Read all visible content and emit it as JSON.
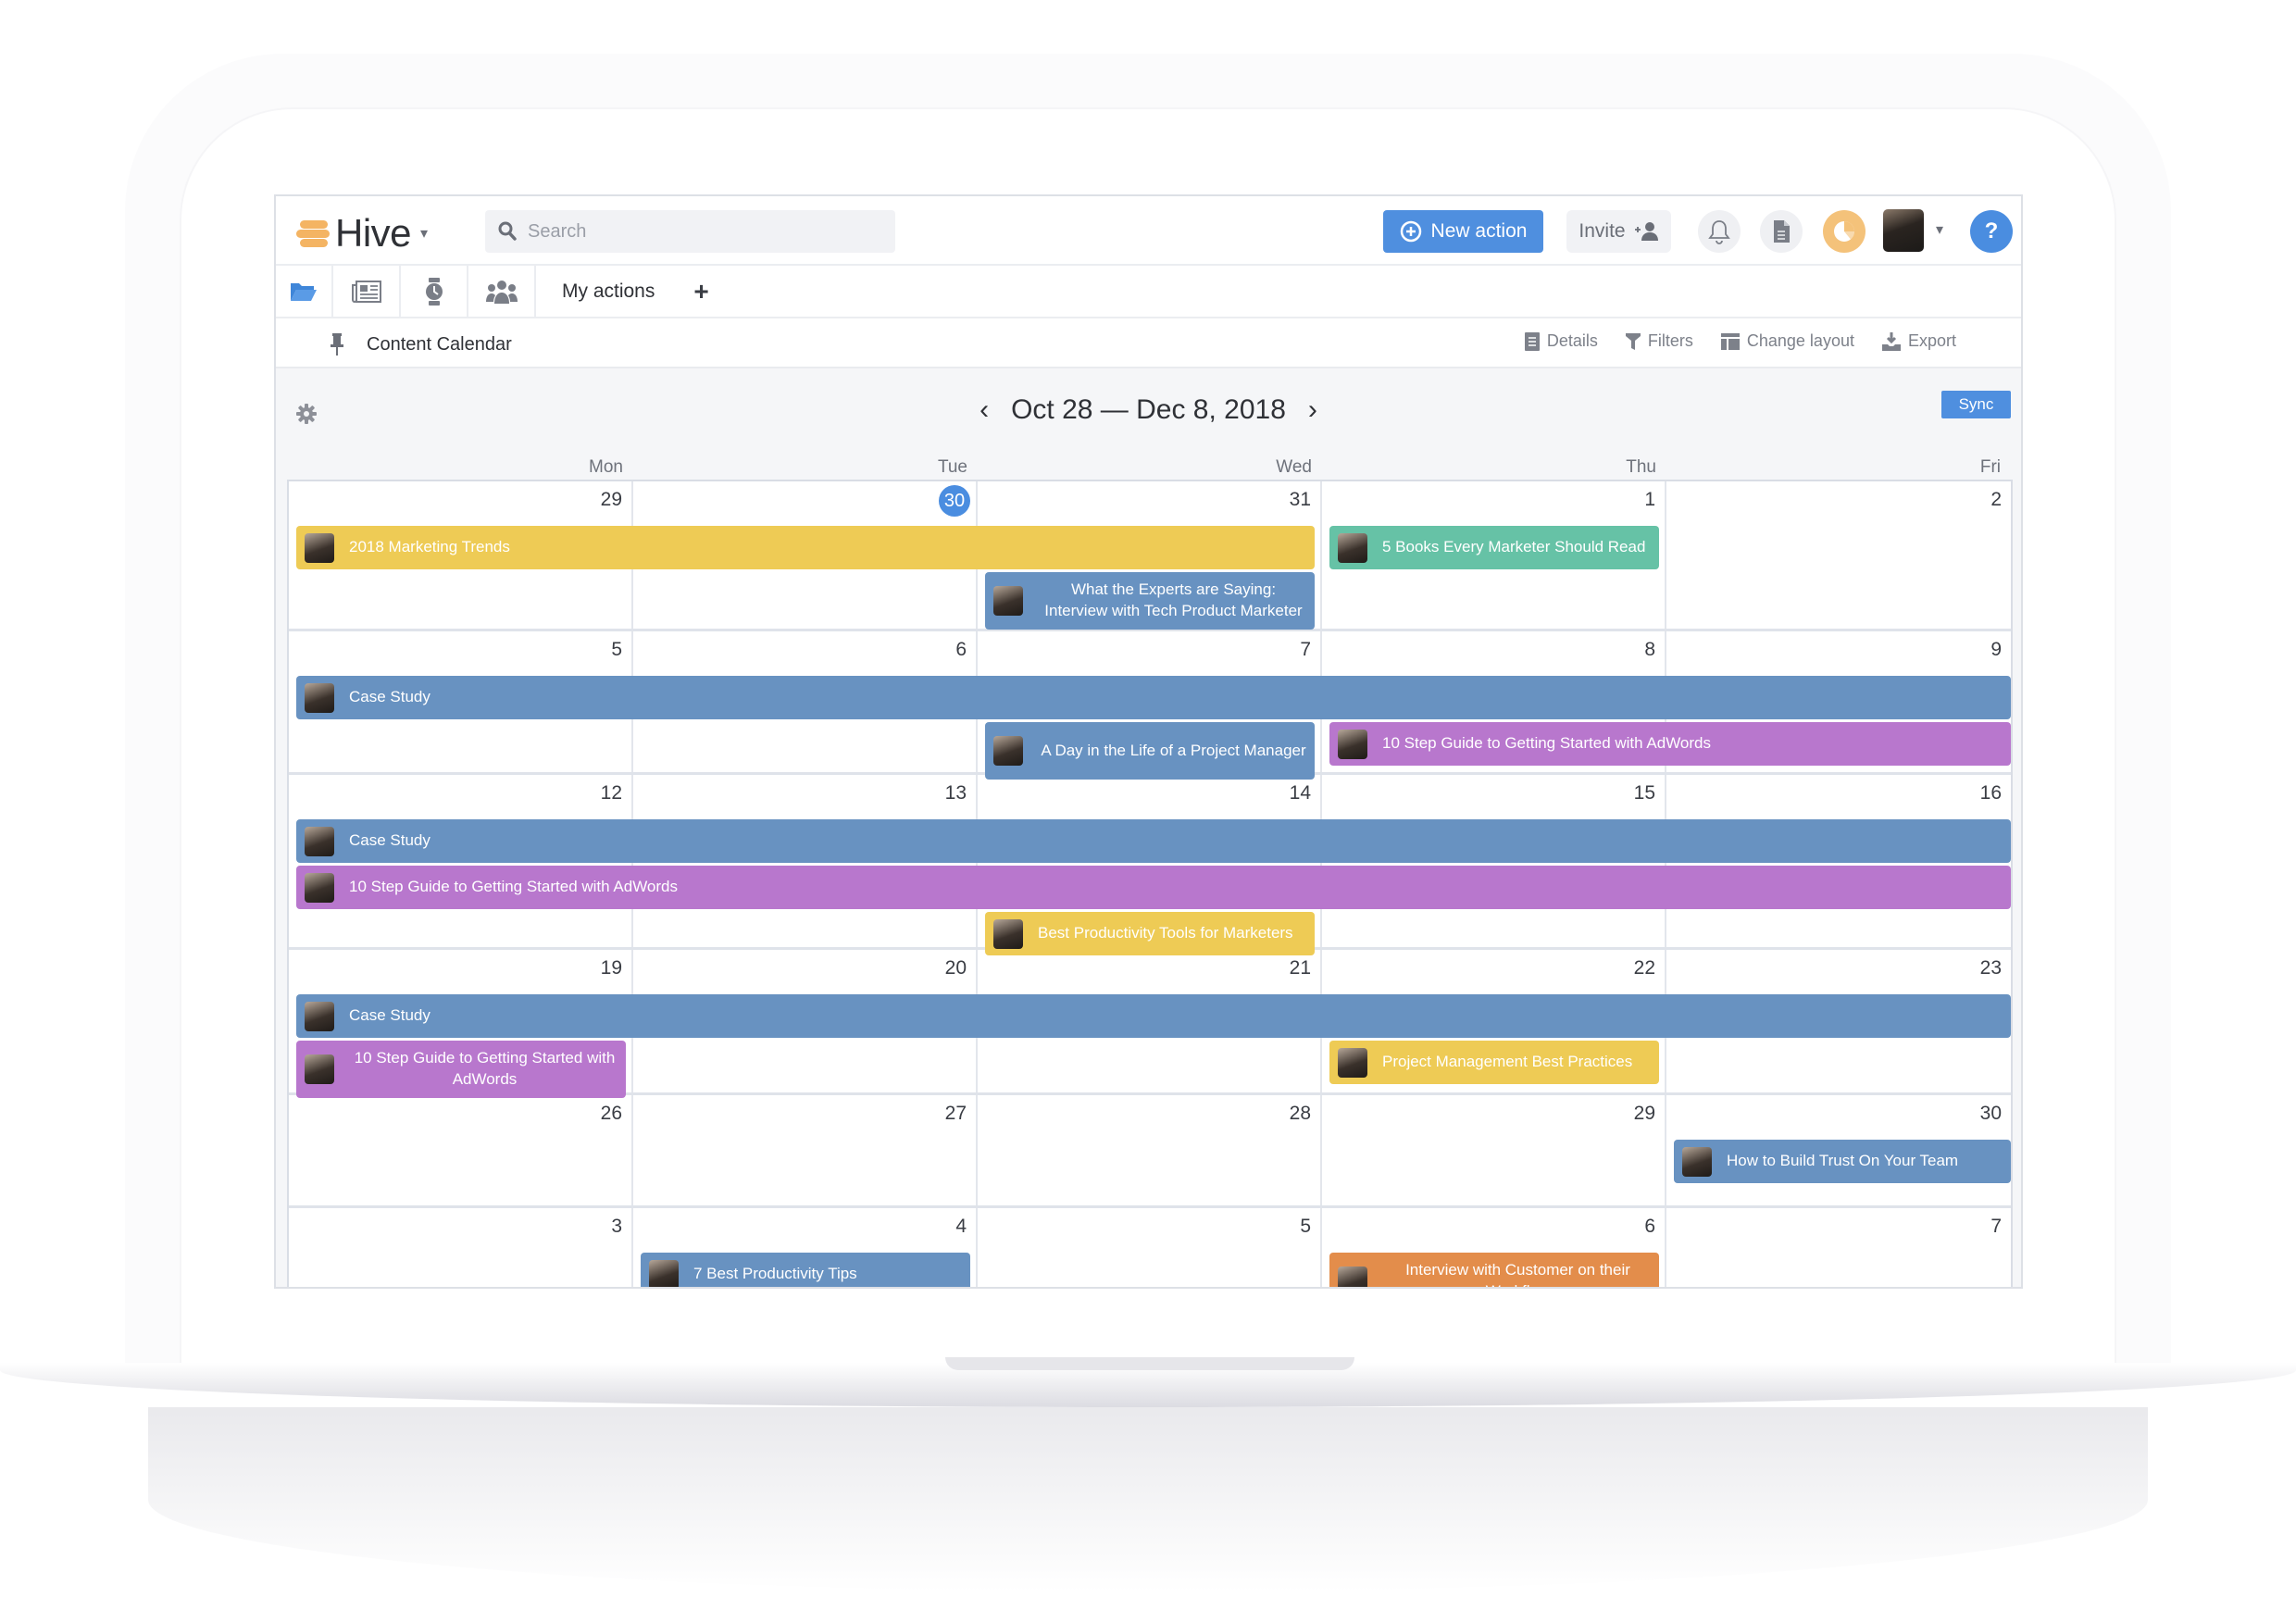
{
  "app": {
    "name": "Hive",
    "search_placeholder": "Search",
    "new_action_label": "New action",
    "invite_label": "Invite",
    "help_label": "?"
  },
  "icons": {
    "search": "search-icon",
    "plus_circle": "plus-circle-icon",
    "add_user": "add-user-icon",
    "bell": "bell-icon",
    "document": "document-icon",
    "pie": "pie-chart-icon",
    "help": "help-icon",
    "folder": "folder-icon",
    "newspaper": "newspaper-icon",
    "timer": "stopwatch-icon",
    "team": "team-icon",
    "pin": "pin-icon",
    "gear": "gear-icon"
  },
  "tabs": {
    "text_tab": "My actions",
    "add_label": "+"
  },
  "project": {
    "title": "Content Calendar",
    "actions": [
      {
        "label": "Details",
        "icon": "details-icon"
      },
      {
        "label": "Filters",
        "icon": "filter-icon"
      },
      {
        "label": "Change layout",
        "icon": "layout-icon"
      },
      {
        "label": "Export",
        "icon": "export-icon"
      }
    ]
  },
  "calendar": {
    "range_label": "Oct 28 — Dec 8, 2018",
    "prev_label": "‹",
    "next_label": "›",
    "sync_label": "Sync",
    "weekdays": [
      "Mon",
      "Tue",
      "Wed",
      "Thu",
      "Fri"
    ],
    "today": "30",
    "weeks": [
      [
        "29",
        "30",
        "31",
        "1",
        "2"
      ],
      [
        "5",
        "6",
        "7",
        "8",
        "9"
      ],
      [
        "12",
        "13",
        "14",
        "15",
        "16"
      ],
      [
        "19",
        "20",
        "21",
        "22",
        "23"
      ],
      [
        "26",
        "27",
        "28",
        "29",
        "30"
      ],
      [
        "3",
        "4",
        "5",
        "6",
        "7"
      ]
    ],
    "colors": {
      "yellow": "#eecb55",
      "blue": "#6892c1",
      "green": "#66c2a6",
      "purple": "#b877cd",
      "orange": "#e38d4b",
      "today": "#4a8de0"
    },
    "events": [
      {
        "title": "2018 Marketing Trends",
        "color": "yellow",
        "week": 0,
        "start": 0,
        "span": 3,
        "lane": 0
      },
      {
        "title": "5 Books Every Marketer Should Read",
        "color": "green",
        "week": 0,
        "start": 3,
        "span": 1,
        "lane": 0
      },
      {
        "title": "What the Experts are Saying: Interview with Tech Product Marketer",
        "color": "blue",
        "week": 0,
        "start": 2,
        "span": 1,
        "lane": 1,
        "tall": true,
        "center": true
      },
      {
        "title": "Case Study",
        "color": "blue",
        "week": 1,
        "start": 0,
        "span": 5,
        "lane": 0
      },
      {
        "title": "A Day in the Life of a Project Manager",
        "color": "blue",
        "week": 1,
        "start": 2,
        "span": 1,
        "lane": 1,
        "tall": true,
        "center": true
      },
      {
        "title": "10 Step Guide to Getting Started with AdWords",
        "color": "purple",
        "week": 1,
        "start": 3,
        "span": 2,
        "lane": 1
      },
      {
        "title": "Case Study",
        "color": "blue",
        "week": 2,
        "start": 0,
        "span": 5,
        "lane": 0
      },
      {
        "title": "10 Step Guide to Getting Started with AdWords",
        "color": "purple",
        "week": 2,
        "start": 0,
        "span": 5,
        "lane": 1
      },
      {
        "title": "Best Productivity Tools for Marketers",
        "color": "yellow",
        "week": 2,
        "start": 2,
        "span": 1,
        "lane": 2
      },
      {
        "title": "Case Study",
        "color": "blue",
        "week": 3,
        "start": 0,
        "span": 5,
        "lane": 0
      },
      {
        "title": "10 Step Guide to Getting Started with AdWords",
        "color": "purple",
        "week": 3,
        "start": 0,
        "span": 1,
        "lane": 1,
        "tall": true,
        "center": true
      },
      {
        "title": "Project Management Best Practices",
        "color": "yellow",
        "week": 3,
        "start": 3,
        "span": 1,
        "lane": 1
      },
      {
        "title": "How to Build Trust On Your Team",
        "color": "blue",
        "week": 4,
        "start": 4,
        "span": 1,
        "lane": 0
      },
      {
        "title": "7 Best Productivity Tips",
        "color": "blue",
        "week": 5,
        "start": 1,
        "span": 1,
        "lane": 0
      },
      {
        "title": "Interview with Customer on their Workflow",
        "color": "orange",
        "week": 5,
        "start": 3,
        "span": 1,
        "lane": 0,
        "tall": true,
        "center": true
      }
    ]
  }
}
